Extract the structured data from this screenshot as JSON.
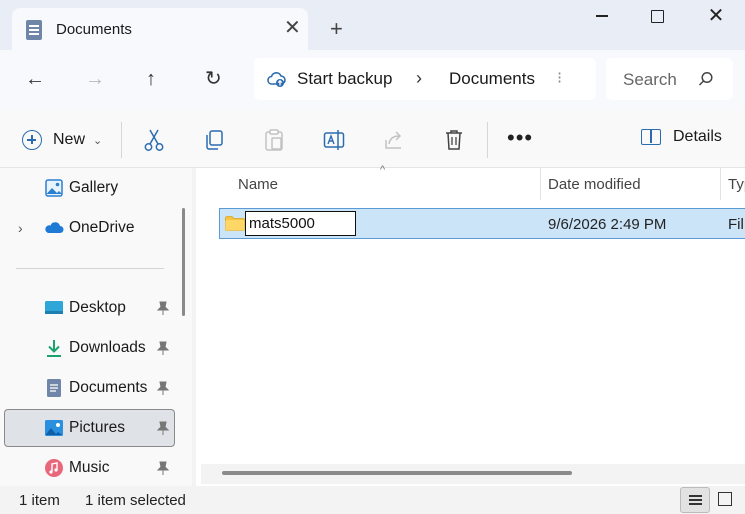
{
  "window": {
    "tab_title": "Documents",
    "tab_close_glyph": "✕",
    "new_tab_glyph": "+",
    "close_glyph": "✕"
  },
  "nav": {
    "back_glyph": "←",
    "forward_glyph": "→",
    "up_glyph": "↑",
    "refresh_glyph": "↻",
    "address": {
      "backup_label": "Start backup",
      "separator": "›",
      "current_folder": "Documents",
      "overflow": "⁝"
    },
    "search_placeholder": "Search"
  },
  "commands": {
    "new_label": "New",
    "new_caret": "⌄",
    "more_glyph": "•••",
    "details_label": "Details"
  },
  "sidebar": {
    "items": [
      {
        "label": "Gallery",
        "icon": "gallery-icon"
      },
      {
        "label": "OneDrive",
        "icon": "onedrive-icon",
        "expand_glyph": "›"
      },
      {
        "label": "Desktop",
        "icon": "desktop-icon",
        "pinned": true
      },
      {
        "label": "Downloads",
        "icon": "downloads-icon",
        "pinned": true
      },
      {
        "label": "Documents",
        "icon": "documents-icon",
        "pinned": true
      },
      {
        "label": "Pictures",
        "icon": "pictures-icon",
        "pinned": true,
        "selected": true
      },
      {
        "label": "Music",
        "icon": "music-icon",
        "pinned": true
      }
    ]
  },
  "table": {
    "columns": [
      "Name",
      "Date modified",
      "Typ"
    ],
    "sort_glyph": "^",
    "rows": [
      {
        "name": "mats5000",
        "date": "9/6/2026 2:49 PM",
        "type": "Fil",
        "icon": "folder-icon",
        "renaming": true
      }
    ]
  },
  "status": {
    "item_count": "1 item",
    "selected": "1 item selected"
  },
  "colors": {
    "accent": "#2b6cb0",
    "selection_bg": "#cce4f7",
    "selection_border": "#5b9bd5"
  }
}
